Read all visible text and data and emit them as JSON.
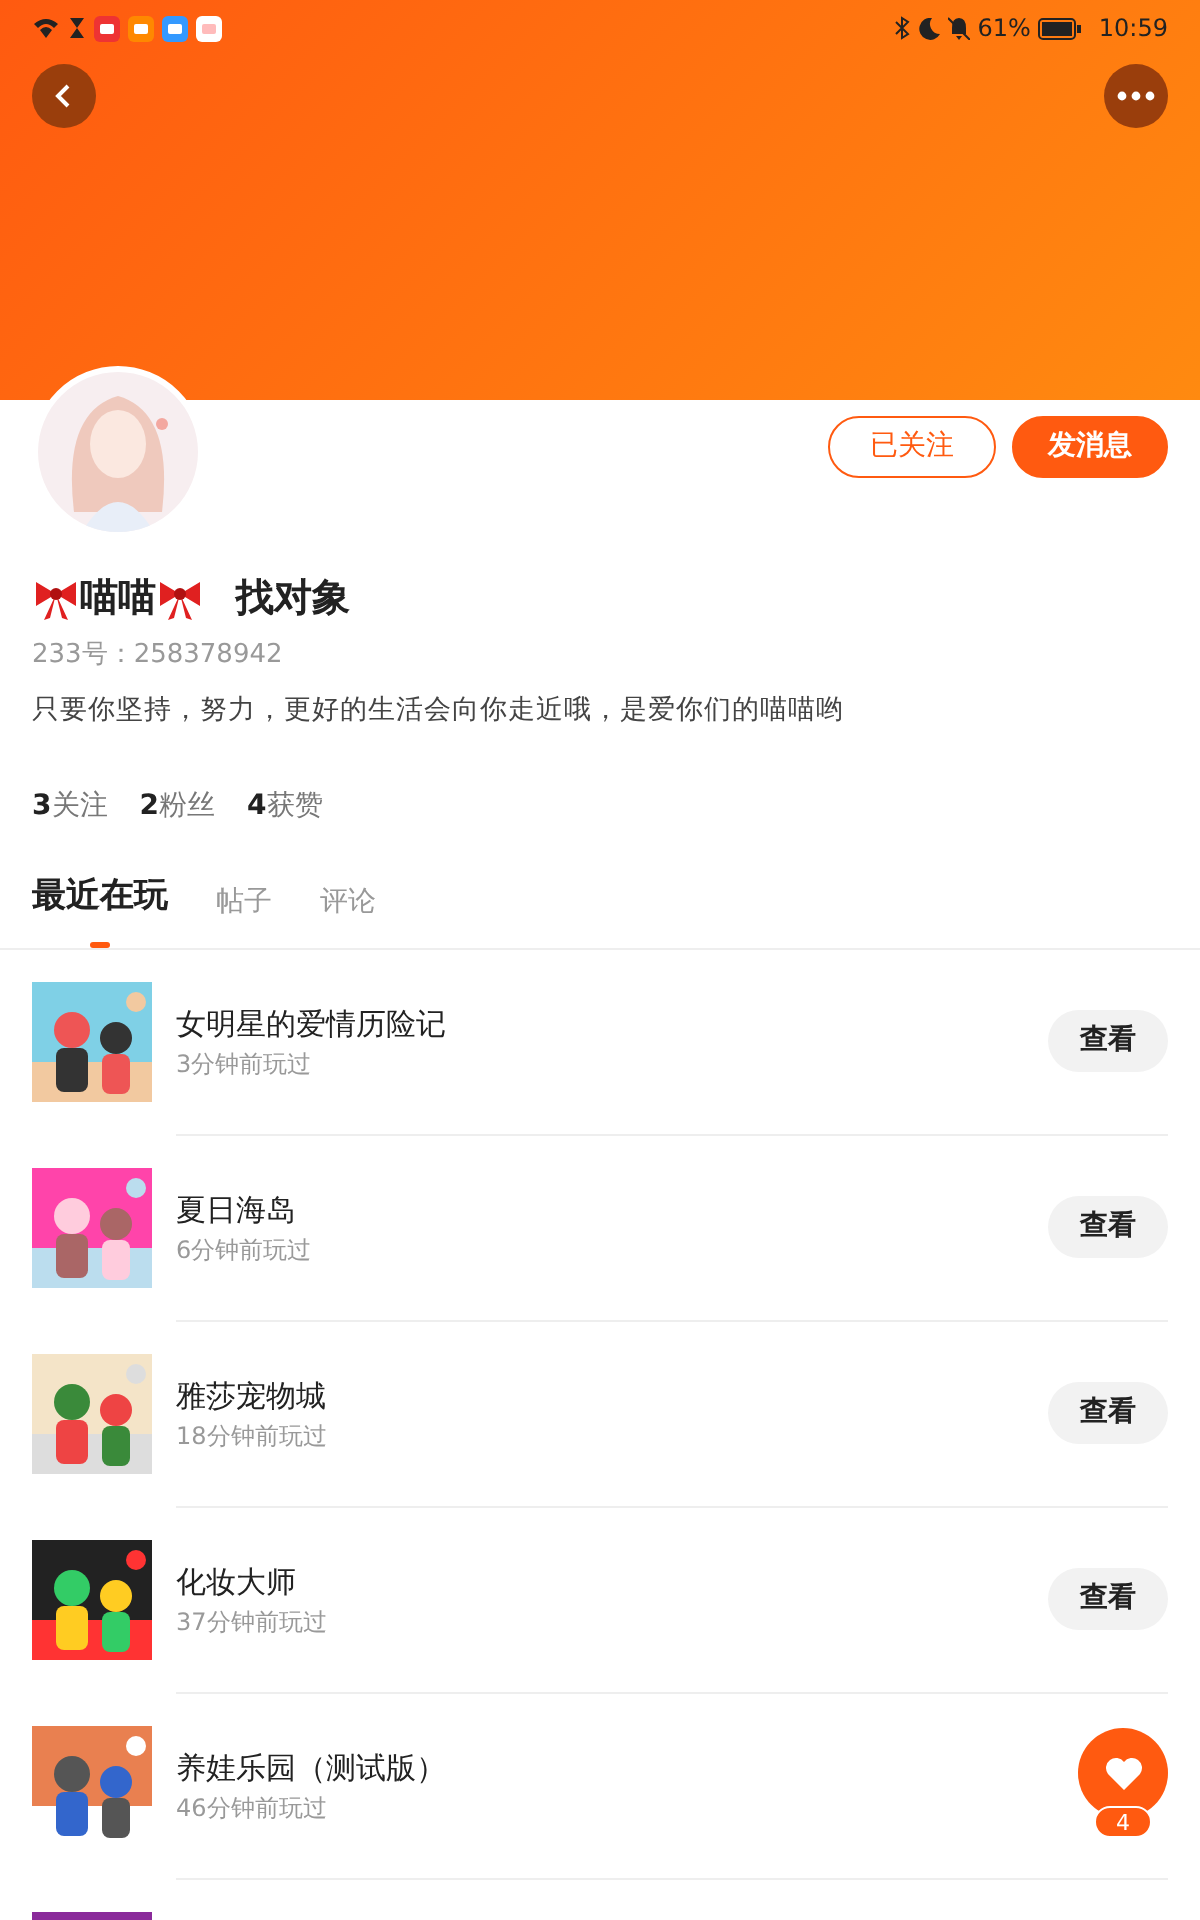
{
  "status_bar": {
    "battery": "61%",
    "time": "10:59"
  },
  "profile": {
    "name": "喵喵",
    "tag": "找对象",
    "id_text": "233号：258378942",
    "bio": "只要你坚持，努力，更好的生活会向你走近哦，是爱你们的喵喵哟",
    "follow_button": "已关注",
    "message_button": "发消息",
    "stats": [
      {
        "count": "3",
        "label": "关注"
      },
      {
        "count": "2",
        "label": "粉丝"
      },
      {
        "count": "4",
        "label": "获赞"
      }
    ]
  },
  "tabs": [
    {
      "label": "最近在玩",
      "selected": true
    },
    {
      "label": "帖子",
      "selected": false
    },
    {
      "label": "评论",
      "selected": false
    }
  ],
  "games": [
    {
      "kind": "game",
      "title": "女明星的爱情历险记",
      "time": "3分钟前玩过",
      "button": "查看"
    },
    {
      "kind": "game",
      "title": "夏日海岛",
      "time": "6分钟前玩过",
      "button": "查看"
    },
    {
      "kind": "game",
      "title": "雅莎宠物城",
      "time": "18分钟前玩过",
      "button": "查看"
    },
    {
      "kind": "game",
      "title": "化妆大师",
      "time": "37分钟前玩过",
      "button": "查看"
    },
    {
      "kind": "game",
      "title": "养娃乐园（测试版）",
      "time": "46分钟前玩过"
    },
    {
      "kind": "picture"
    }
  ],
  "like_button": {
    "count": "4"
  }
}
